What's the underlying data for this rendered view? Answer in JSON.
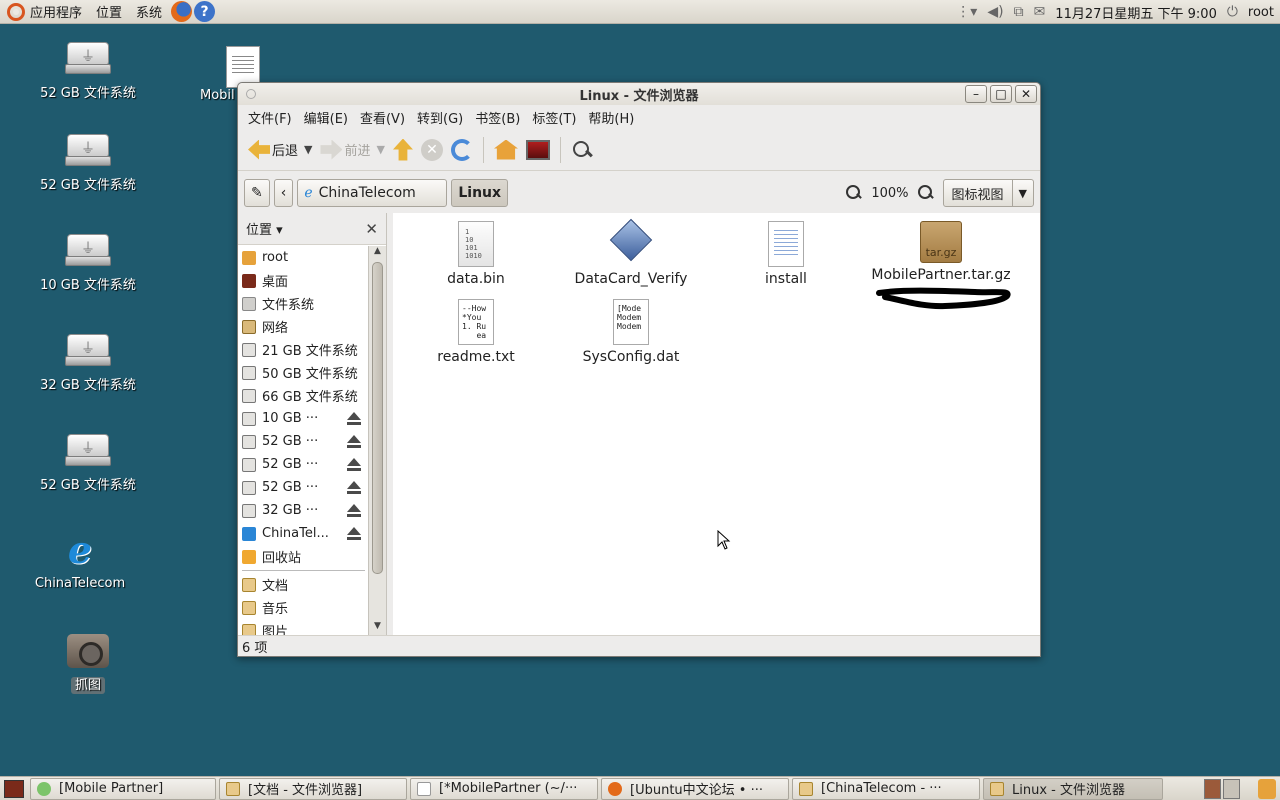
{
  "top_panel": {
    "apps": "应用程序",
    "places": "位置",
    "system": "系统",
    "clock": "11月27日星期五 下午 9:00",
    "user": "root"
  },
  "desktop_icons": [
    {
      "label": "52 GB 文件系统",
      "type": "drive"
    },
    {
      "label": "52 GB 文件系统",
      "type": "drive"
    },
    {
      "label": "10 GB 文件系统",
      "type": "drive"
    },
    {
      "label": "32 GB 文件系统",
      "type": "drive"
    },
    {
      "label": "52 GB 文件系统",
      "type": "drive"
    },
    {
      "label": "ChinaTelecom",
      "type": "telecom"
    },
    {
      "label": "抓图",
      "type": "camera"
    },
    {
      "label": "Mobil",
      "type": "document"
    }
  ],
  "window": {
    "title": "Linux - 文件浏览器",
    "menu": [
      "文件(F)",
      "编辑(E)",
      "查看(V)",
      "转到(G)",
      "书签(B)",
      "标签(T)",
      "帮助(H)"
    ],
    "toolbar": {
      "back": "后退",
      "forward": "前进"
    },
    "location": {
      "prev_crumb": "ChinaTelecom",
      "current_crumb": "Linux",
      "zoom": "100%",
      "view_mode": "图标视图"
    },
    "sidebar": {
      "header": "位置",
      "items": [
        {
          "label": "root",
          "icon": "home-icon",
          "eject": false
        },
        {
          "label": "桌面",
          "icon": "desktop-icon",
          "eject": false
        },
        {
          "label": "文件系统",
          "icon": "filesystem-icon",
          "eject": false
        },
        {
          "label": "网络",
          "icon": "network-icon",
          "eject": false
        },
        {
          "label": "21 GB 文件系统",
          "icon": "drive-icon",
          "eject": false
        },
        {
          "label": "50 GB 文件系统",
          "icon": "drive-icon",
          "eject": false
        },
        {
          "label": "66 GB 文件系统",
          "icon": "drive-icon",
          "eject": false
        },
        {
          "label": "10 GB ···",
          "icon": "usb-drive-icon",
          "eject": true
        },
        {
          "label": "52 GB ···",
          "icon": "usb-drive-icon",
          "eject": true
        },
        {
          "label": "52 GB ···",
          "icon": "usb-drive-icon",
          "eject": true
        },
        {
          "label": "52 GB ···",
          "icon": "usb-drive-icon",
          "eject": true
        },
        {
          "label": "32 GB ···",
          "icon": "usb-drive-icon",
          "eject": true
        },
        {
          "label": "ChinaTel...",
          "icon": "chinatelecom-icon",
          "eject": true
        },
        {
          "label": "回收站",
          "icon": "trash-icon",
          "eject": false
        }
      ],
      "bookmarks": [
        {
          "label": "文档",
          "icon": "folder-icon"
        },
        {
          "label": "音乐",
          "icon": "music-folder-icon"
        },
        {
          "label": "图片",
          "icon": "pictures-folder-icon"
        }
      ]
    },
    "files": [
      {
        "name": "data.bin",
        "icon": "binary-file-icon",
        "preview": "1\n10\n101\n1010"
      },
      {
        "name": "DataCard_Verify",
        "icon": "executable-icon",
        "preview": ""
      },
      {
        "name": "install",
        "icon": "script-icon",
        "preview": ""
      },
      {
        "name": "MobilePartner.tar.gz",
        "icon": "archive-icon",
        "preview": "tar.gz"
      },
      {
        "name": "readme.txt",
        "icon": "text-file-icon",
        "preview": "--How\n*You\n1. Ru\n   ea"
      },
      {
        "name": "SysConfig.dat",
        "icon": "text-file-icon",
        "preview": "[Mode\nModem\nModem"
      }
    ],
    "status": "6 项"
  },
  "taskbar": [
    {
      "label": "[Mobile Partner]",
      "active": false
    },
    {
      "label": "[文档 - 文件浏览器]",
      "active": false
    },
    {
      "label": "[*MobilePartner (~/···",
      "active": false
    },
    {
      "label": "[Ubuntu中文论坛 • ···",
      "active": false
    },
    {
      "label": "[ChinaTelecom   - ···",
      "active": false
    },
    {
      "label": "Linux - 文件浏览器",
      "active": true
    }
  ]
}
